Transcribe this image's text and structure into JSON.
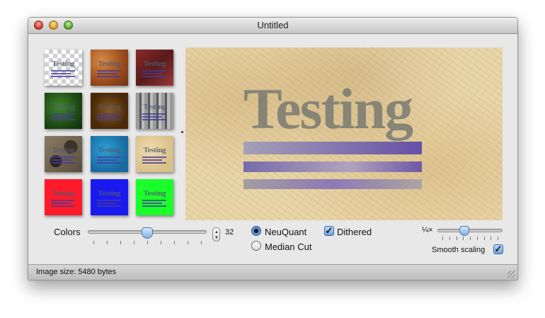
{
  "window": {
    "title": "Untitled"
  },
  "thumbnails": [
    {
      "name": "transparent",
      "label": "Testing"
    },
    {
      "name": "rust",
      "label": "Testing"
    },
    {
      "name": "maroon",
      "label": "Testing"
    },
    {
      "name": "green-leaves",
      "label": "Testing"
    },
    {
      "name": "brown-texture",
      "label": "Testing"
    },
    {
      "name": "gray-stripes",
      "label": "Testing"
    },
    {
      "name": "stones",
      "label": "Testing"
    },
    {
      "name": "blue-water",
      "label": "Testing"
    },
    {
      "name": "parchment",
      "label": "Testing"
    },
    {
      "name": "red",
      "label": "Testing"
    },
    {
      "name": "blue",
      "label": "Testing"
    },
    {
      "name": "green",
      "label": "Testing"
    }
  ],
  "preview": {
    "text": "Testing"
  },
  "controls": {
    "colors_label": "Colors",
    "colors_value": "32",
    "colors_level": 0.5,
    "neuquant_label": "NeuQuant",
    "median_cut_label": "Median Cut",
    "dithered_label": "Dithered",
    "zoom_label": "¼×",
    "zoom_level": 0.4,
    "smooth_scaling_label": "Smooth scaling"
  },
  "status": {
    "image_size": "Image size: 5480 bytes"
  }
}
